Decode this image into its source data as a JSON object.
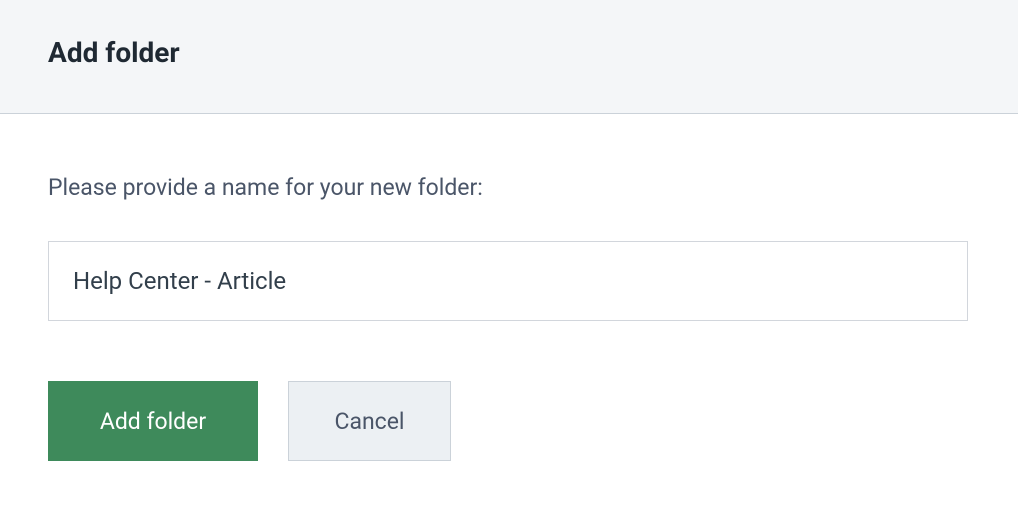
{
  "header": {
    "title": "Add folder"
  },
  "form": {
    "prompt": "Please provide a name for your new folder:",
    "folder_name_value": "Help Center - Article"
  },
  "buttons": {
    "submit_label": "Add folder",
    "cancel_label": "Cancel"
  },
  "colors": {
    "primary": "#3e8a5b",
    "header_bg": "#f4f6f8",
    "border": "#cbd2d9",
    "text_dark": "#1f2933",
    "text_body": "#4a5568"
  }
}
